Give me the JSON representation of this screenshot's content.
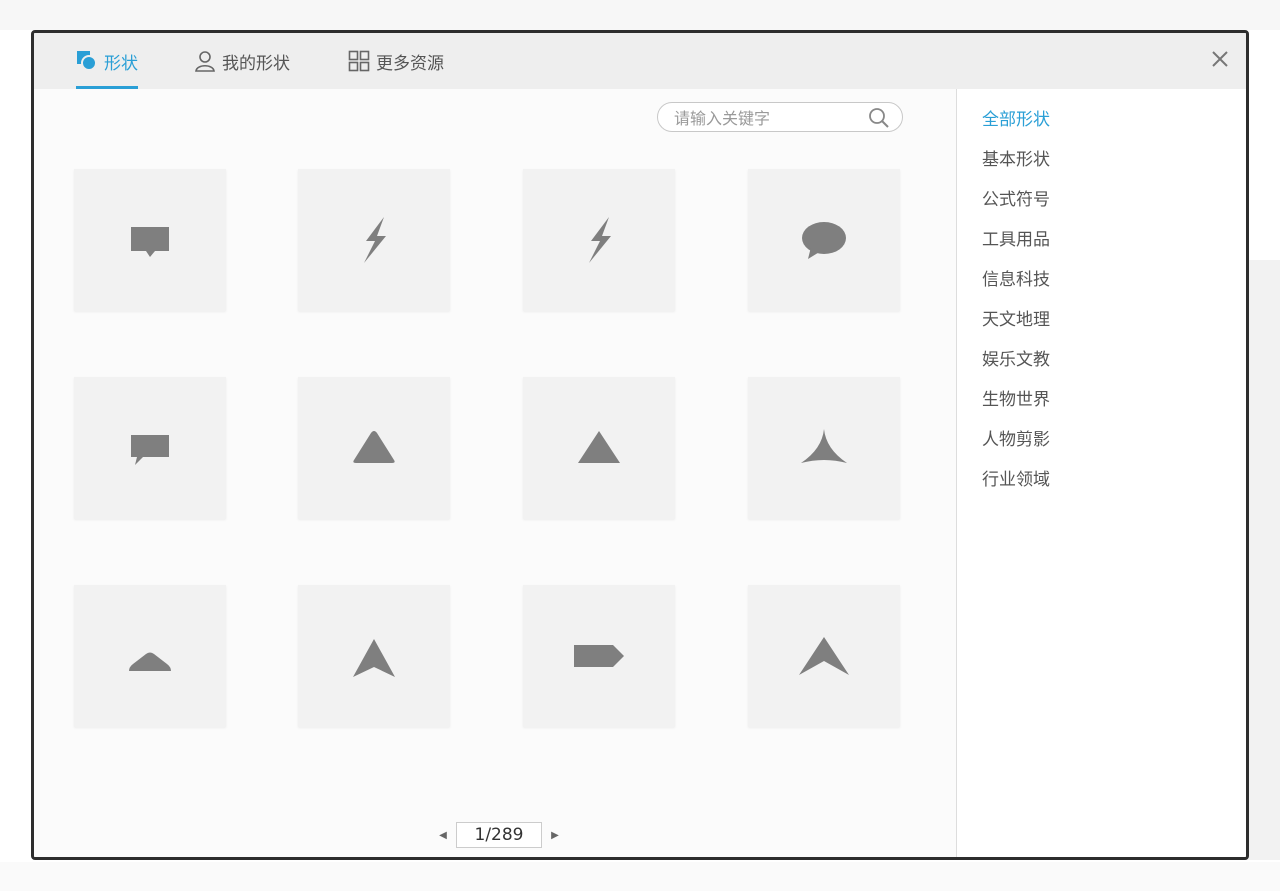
{
  "window": {
    "close_label": "×"
  },
  "tabs": [
    {
      "label": "形状",
      "icon": "shapes-icon",
      "active": true
    },
    {
      "label": "我的形状",
      "icon": "user-icon",
      "active": false
    },
    {
      "label": "更多资源",
      "icon": "grid-icon",
      "active": false
    }
  ],
  "search": {
    "placeholder": "请输入关键字",
    "value": ""
  },
  "shapes": [
    {
      "icon": "speech-bubble-rect-icon"
    },
    {
      "icon": "lightning-bolt-icon"
    },
    {
      "icon": "lightning-bolt-icon"
    },
    {
      "icon": "speech-bubble-oval-icon"
    },
    {
      "icon": "speech-bubble-rect-icon"
    },
    {
      "icon": "rounded-triangle-icon"
    },
    {
      "icon": "triangle-icon"
    },
    {
      "icon": "curved-star-point-icon"
    },
    {
      "icon": "rounded-mound-icon"
    },
    {
      "icon": "arrowhead-icon"
    },
    {
      "icon": "tag-pentagon-icon"
    },
    {
      "icon": "chevron-up-arrow-icon"
    }
  ],
  "pager": {
    "page_text": "1/289",
    "prev_glyph": "◀",
    "next_glyph": "▶"
  },
  "categories": [
    {
      "label": "全部形状",
      "active": true
    },
    {
      "label": "基本形状",
      "active": false
    },
    {
      "label": "公式符号",
      "active": false
    },
    {
      "label": "工具用品",
      "active": false
    },
    {
      "label": "信息科技",
      "active": false
    },
    {
      "label": "天文地理",
      "active": false
    },
    {
      "label": "娱乐文教",
      "active": false
    },
    {
      "label": "生物世界",
      "active": false
    },
    {
      "label": "人物剪影",
      "active": false
    },
    {
      "label": "行业领域",
      "active": false
    }
  ],
  "colors": {
    "accent": "#2a9fd6",
    "shape_fill": "#7f7f7f",
    "card_bg": "#f2f2f2"
  }
}
